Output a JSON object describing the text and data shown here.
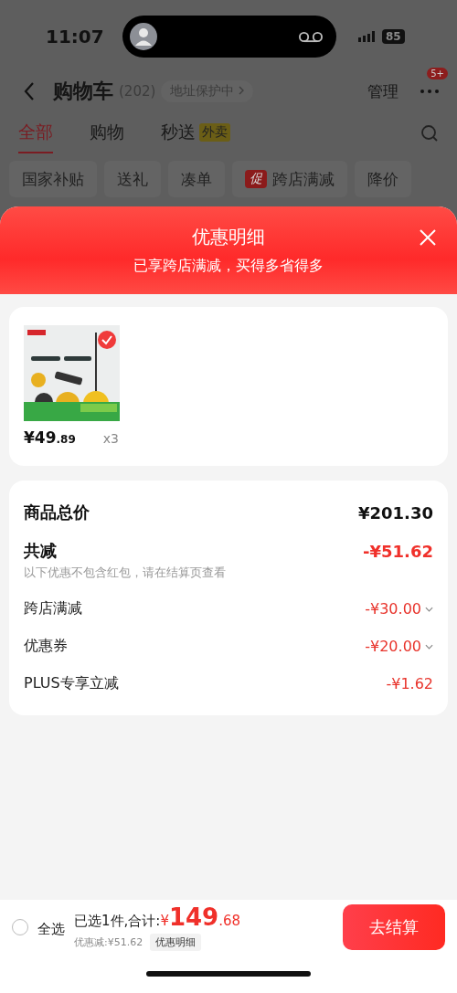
{
  "status_bar": {
    "time": "11:07",
    "battery": "85"
  },
  "header": {
    "title": "购物车",
    "count": "(202)",
    "address_badge": "地址保护中",
    "manage": "管理",
    "more_badge": "5+"
  },
  "tabs": [
    {
      "label": "全部",
      "selected": true
    },
    {
      "label": "购物",
      "selected": false
    },
    {
      "label": "秒送",
      "selected": false,
      "tag": "外卖"
    }
  ],
  "chips": [
    {
      "label": "国家补贴"
    },
    {
      "label": "送礼"
    },
    {
      "label": "凑单"
    },
    {
      "label": "跨店满减",
      "tag": "促"
    },
    {
      "label": "降价"
    }
  ],
  "sheet": {
    "title": "优惠明细",
    "subtitle": "已享跨店满减，买得多省得多"
  },
  "products": [
    {
      "kind": "picture",
      "checked": true,
      "price_main": "¥49",
      "price_decimal": ".89",
      "quantity": "x3"
    }
  ],
  "summary": {
    "total_label": "商品总价",
    "total": "¥201.30",
    "discount_label": "共减",
    "discount": "-¥51.62",
    "note": "以下优惠不包含红包，请在结算页查看",
    "items": [
      {
        "label": "跨店满减",
        "amount": "-¥30.00",
        "expandable": true
      },
      {
        "label": "优惠券",
        "amount": "-¥20.00",
        "expandable": true
      },
      {
        "label": "PLUS专享立减",
        "amount": "-¥1.62",
        "expandable": false
      }
    ]
  },
  "footer": {
    "select_all_label": "全选",
    "select_all_checked": false,
    "selected_text": "已选1件,合计:",
    "currency": "¥",
    "total_main": "149",
    "total_decimal": ".68",
    "saved": "优惠减:¥51.62",
    "details_button": "优惠明细",
    "checkout": "去结算"
  }
}
